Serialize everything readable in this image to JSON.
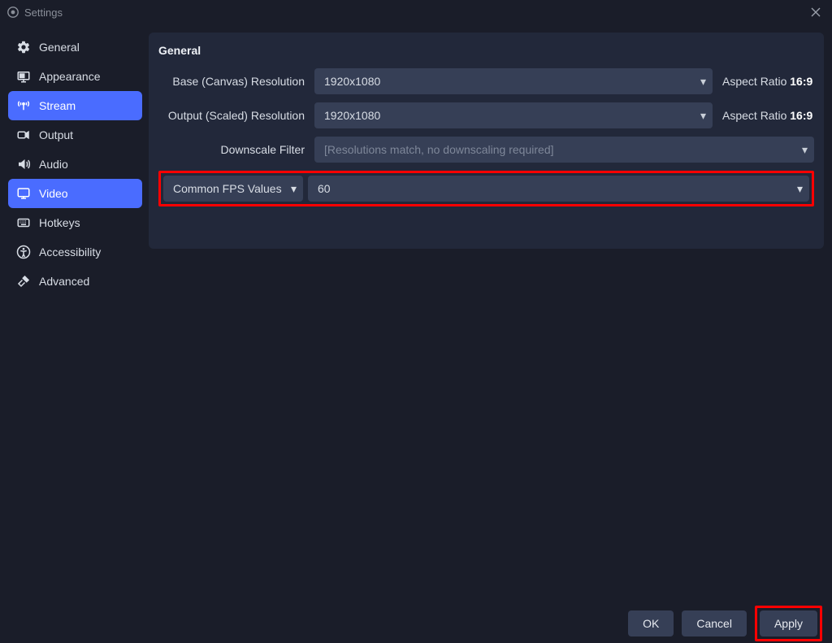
{
  "window": {
    "title": "Settings"
  },
  "sidebar": {
    "items": [
      {
        "label": "General",
        "icon": "gear"
      },
      {
        "label": "Appearance",
        "icon": "display"
      },
      {
        "label": "Stream",
        "icon": "antenna",
        "highlight": true
      },
      {
        "label": "Output",
        "icon": "camcorder"
      },
      {
        "label": "Audio",
        "icon": "speaker"
      },
      {
        "label": "Video",
        "icon": "monitor",
        "active": true
      },
      {
        "label": "Hotkeys",
        "icon": "keyboard"
      },
      {
        "label": "Accessibility",
        "icon": "accessibility"
      },
      {
        "label": "Advanced",
        "icon": "tools"
      }
    ]
  },
  "section": {
    "title": "General"
  },
  "form": {
    "base_label": "Base (Canvas) Resolution",
    "base_value": "1920x1080",
    "output_label": "Output (Scaled) Resolution",
    "output_value": "1920x1080",
    "downscale_label": "Downscale Filter",
    "downscale_value": "[Resolutions match, no downscaling required]",
    "aspect_prefix": "Aspect Ratio",
    "aspect_value": "16:9",
    "fps_type_label": "Common FPS Values",
    "fps_value": "60"
  },
  "buttons": {
    "ok": "OK",
    "cancel": "Cancel",
    "apply": "Apply"
  }
}
